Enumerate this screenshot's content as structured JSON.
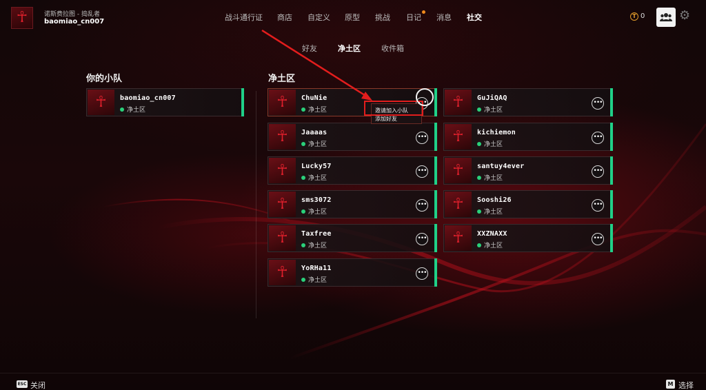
{
  "app": {
    "subtitle": "诺斯费拉图 - 捣乱者",
    "username": "baomiao_cn007"
  },
  "nav": {
    "items": [
      {
        "label": "战斗通行证",
        "active": false
      },
      {
        "label": "商店",
        "active": false
      },
      {
        "label": "自定义",
        "active": false
      },
      {
        "label": "原型",
        "active": false
      },
      {
        "label": "挑战",
        "active": false
      },
      {
        "label": "日记",
        "active": false,
        "notification": true
      },
      {
        "label": "消息",
        "active": false
      },
      {
        "label": "社交",
        "active": true
      }
    ]
  },
  "currency": {
    "icon": "T",
    "value": "0"
  },
  "subtabs": [
    {
      "label": "好友",
      "active": false
    },
    {
      "label": "净土区",
      "active": true
    },
    {
      "label": "收件箱",
      "active": false
    }
  ],
  "squad": {
    "title": "你的小队",
    "members": [
      {
        "name": "baomiao_cn007",
        "status": "净土区"
      }
    ]
  },
  "region": {
    "title": "净土区",
    "players": [
      {
        "name": "ChuNie",
        "status": "净土区"
      },
      {
        "name": "GuJiQAQ",
        "status": "净土区"
      },
      {
        "name": "Jaaaas",
        "status": "净土区"
      },
      {
        "name": "kichiemon",
        "status": "净土区"
      },
      {
        "name": "Lucky57",
        "status": "净土区"
      },
      {
        "name": "santuy4ever",
        "status": "净土区"
      },
      {
        "name": "sms3072",
        "status": "净土区"
      },
      {
        "name": "Sooshi26",
        "status": "净土区"
      },
      {
        "name": "Taxfree",
        "status": "净土区"
      },
      {
        "name": "XXZNAXX",
        "status": "净土区"
      },
      {
        "name": "YoRHa11",
        "status": "净土区"
      }
    ]
  },
  "context_menu": {
    "items": [
      "邀请加入小队",
      "添加好友"
    ]
  },
  "footer": {
    "esc_key": "ESC",
    "close_label": "关闭",
    "select_key": "M",
    "select_label": "选择"
  },
  "colors": {
    "online": "#2ad07a",
    "accent_bar": "#20d088",
    "highlight": "#e21d1d",
    "notification": "#f08a1c"
  }
}
